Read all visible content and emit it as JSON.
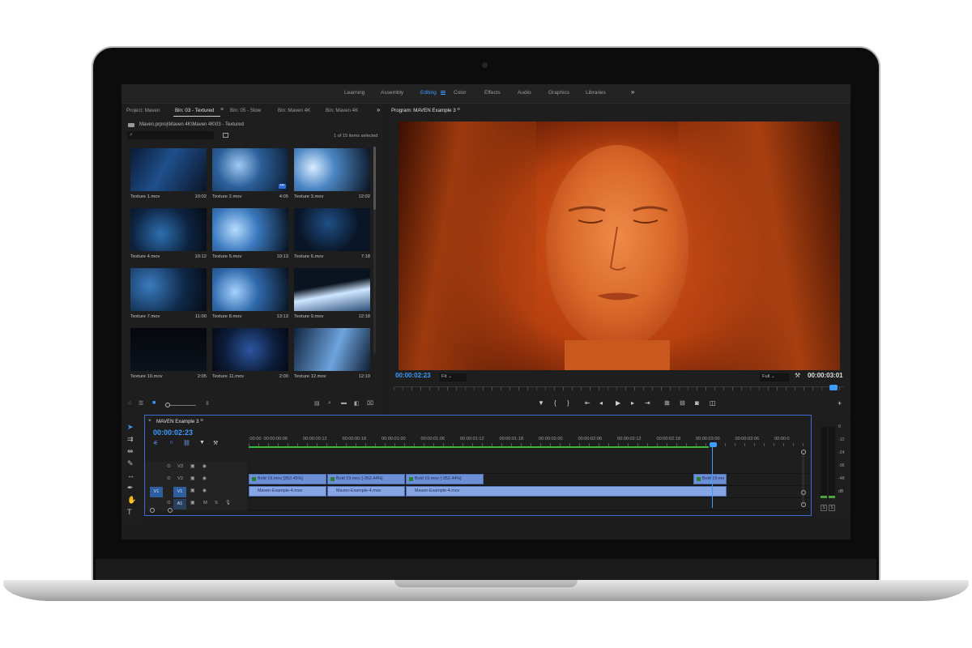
{
  "workspaces": {
    "tabs": [
      "Learning",
      "Assembly",
      "Editing",
      "Color",
      "Effects",
      "Audio",
      "Graphics",
      "Libraries"
    ],
    "active": "Editing",
    "more": "»"
  },
  "project": {
    "tabs": [
      "Project: Maven",
      "Bin: 03 - Textured",
      "Bin: 05 - Slow",
      "Bin: Maven 4K",
      "Bin: Maven 4K"
    ],
    "more": "»",
    "path": "Maven.prproj\\Maven 4K\\Maven 4K\\03 - Textured",
    "search_placeholder": "",
    "selection_count": "1 of 15 items selected",
    "clips": [
      {
        "name": "Texture 1.mov",
        "duration": "10:02"
      },
      {
        "name": "Texture 2.mov",
        "duration": "4:05"
      },
      {
        "name": "Texture 3.mov",
        "duration": "12:02"
      },
      {
        "name": "Texture 4.mov",
        "duration": "10:12"
      },
      {
        "name": "Texture 5.mov",
        "duration": "10:13"
      },
      {
        "name": "Texture 6.mov",
        "duration": "7:18"
      },
      {
        "name": "Texture 7.mov",
        "duration": "11:00"
      },
      {
        "name": "Texture 8.mov",
        "duration": "13:13"
      },
      {
        "name": "Texture 9.mov",
        "duration": "12:18"
      },
      {
        "name": "Texture 10.mov",
        "duration": "2:05"
      },
      {
        "name": "Texture 11.mov",
        "duration": "2:00"
      },
      {
        "name": "Texture 12.mov",
        "duration": "12:10"
      }
    ]
  },
  "program": {
    "title": "Program: MAVEN Example 3",
    "current_timecode": "00:00:02:23",
    "zoom": "Fit",
    "resolution": "Full",
    "duration_timecode": "00:00:03:01"
  },
  "timeline": {
    "sequence": "MAVEN Example 3",
    "timecode": "00:00:02:23",
    "ruler": [
      ":00:00",
      "00:00:00:06",
      "00:00:00:12",
      "00:00:00:18",
      "00:00:01:00",
      "00:00:01:06",
      "00:00:01:12",
      "00:00:01:18",
      "00:00:02:00",
      "00:00:02:06",
      "00:00:02:12",
      "00:00:02:18",
      "00:00:03:00",
      "00:00:03:06",
      "00:00:0"
    ],
    "tracks": {
      "v3": "V3",
      "v2": "V2",
      "v1": "V1",
      "a1": "A1",
      "m": "M",
      "s": "S"
    },
    "v2_clips": [
      "Bold 19.mov [352.45%]",
      "Bold 19.mov [-352.44%]",
      "Bold 19.mov [-352.44%]",
      "Bold 19.mo"
    ],
    "v1_clips": [
      "Maven-Example-4.mov",
      "Maven-Example-4.mov",
      "Maven-Example-4.mov"
    ]
  },
  "meter": {
    "labels": [
      "0",
      "-12",
      "-24",
      "-36",
      "-48",
      "dB"
    ],
    "solo": [
      "S",
      "S"
    ]
  },
  "colors": {
    "accent": "#3e9bff",
    "panel_bg": "#1e1e1e",
    "clip_blue": "#6d8fd6",
    "video_orange": "#d5531a"
  }
}
